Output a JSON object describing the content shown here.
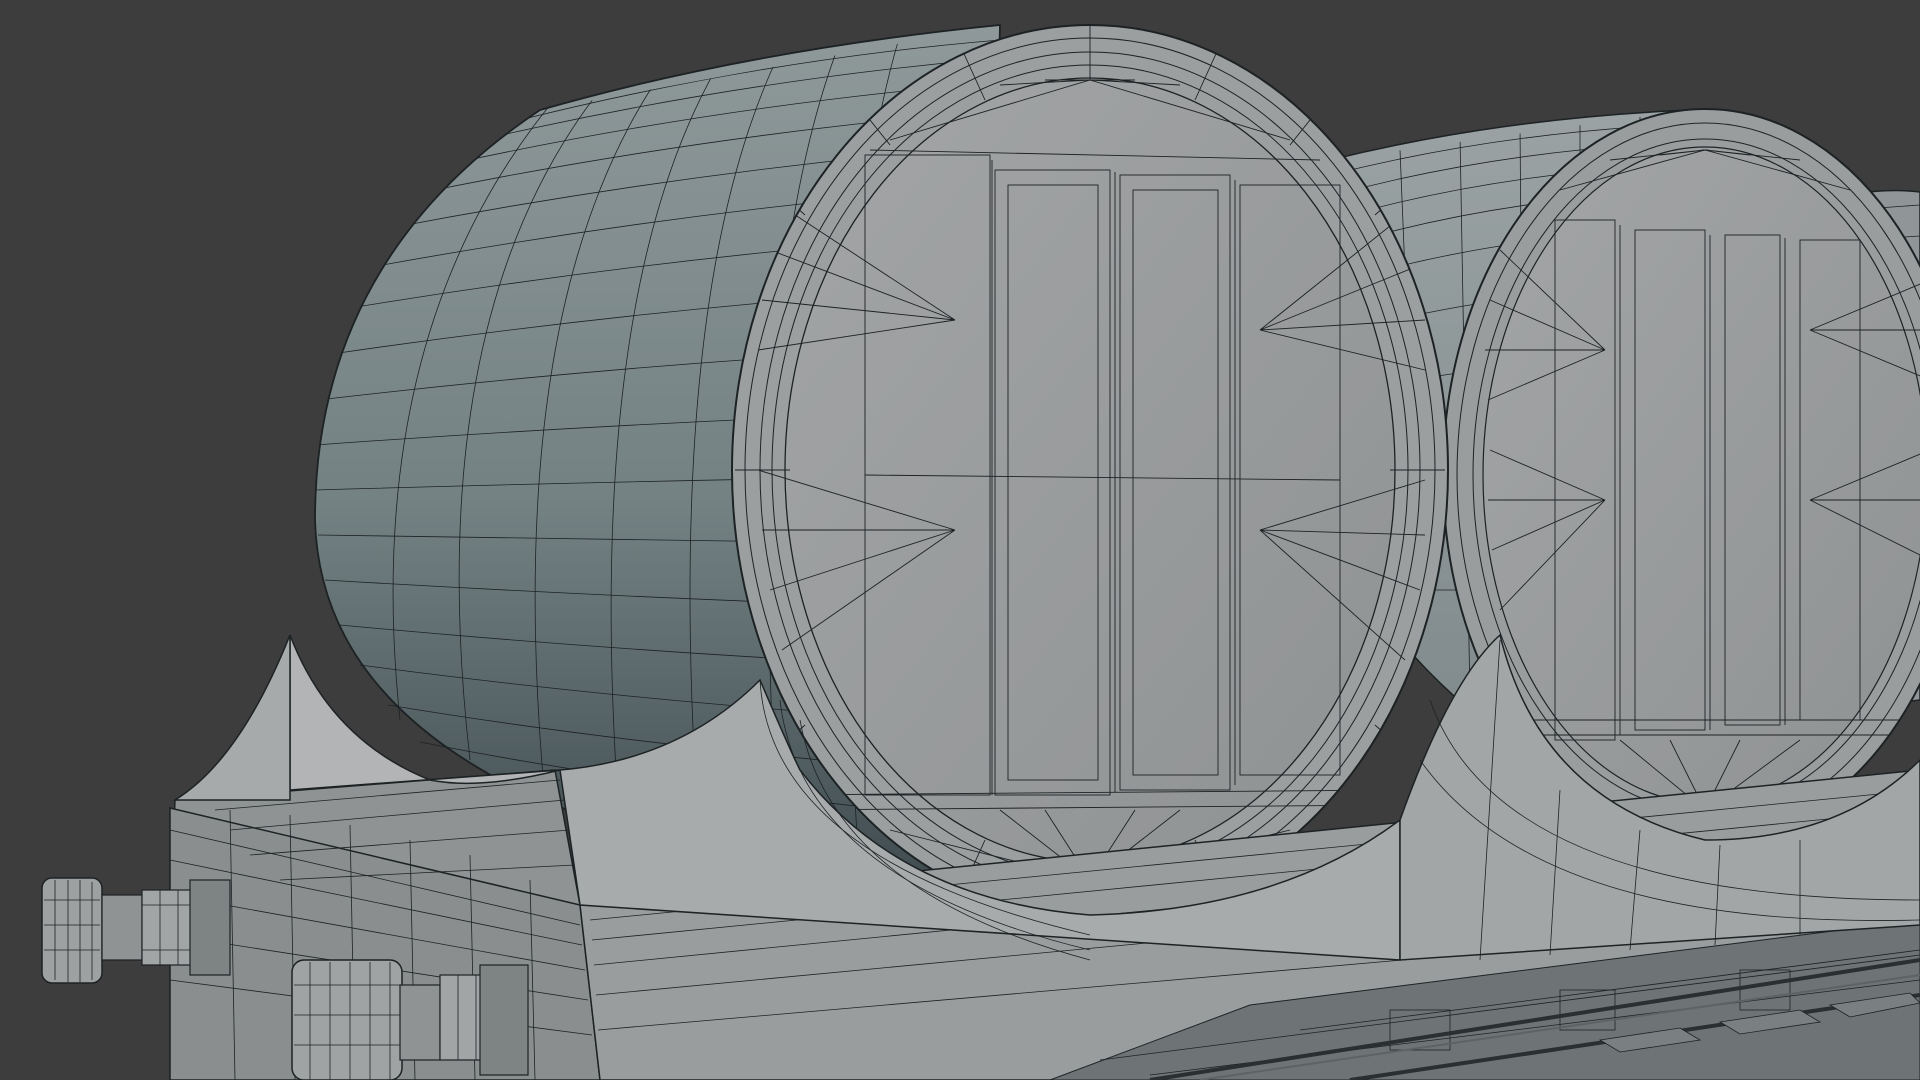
{
  "viewport": {
    "background": "#3d3d3d",
    "shading": "solid-grey-with-wireframe-overlay"
  },
  "scene": {
    "subject": "wagon-with-cylindrical-tanks",
    "objects": [
      "tank-1",
      "tank-1-end-cap",
      "tank-1-saddle",
      "tank-2",
      "tank-2-end-cap",
      "tank-2-saddle",
      "tank-3-partial",
      "wagon-chassis",
      "buffer-left",
      "buffer-right",
      "rails"
    ]
  },
  "colors": {
    "background": "#3d3d3d",
    "mesh_light": "#a4a7a9",
    "mesh_mid": "#8f9596",
    "mesh_dark": "#3f4c4f",
    "wire": "#1d2224"
  }
}
